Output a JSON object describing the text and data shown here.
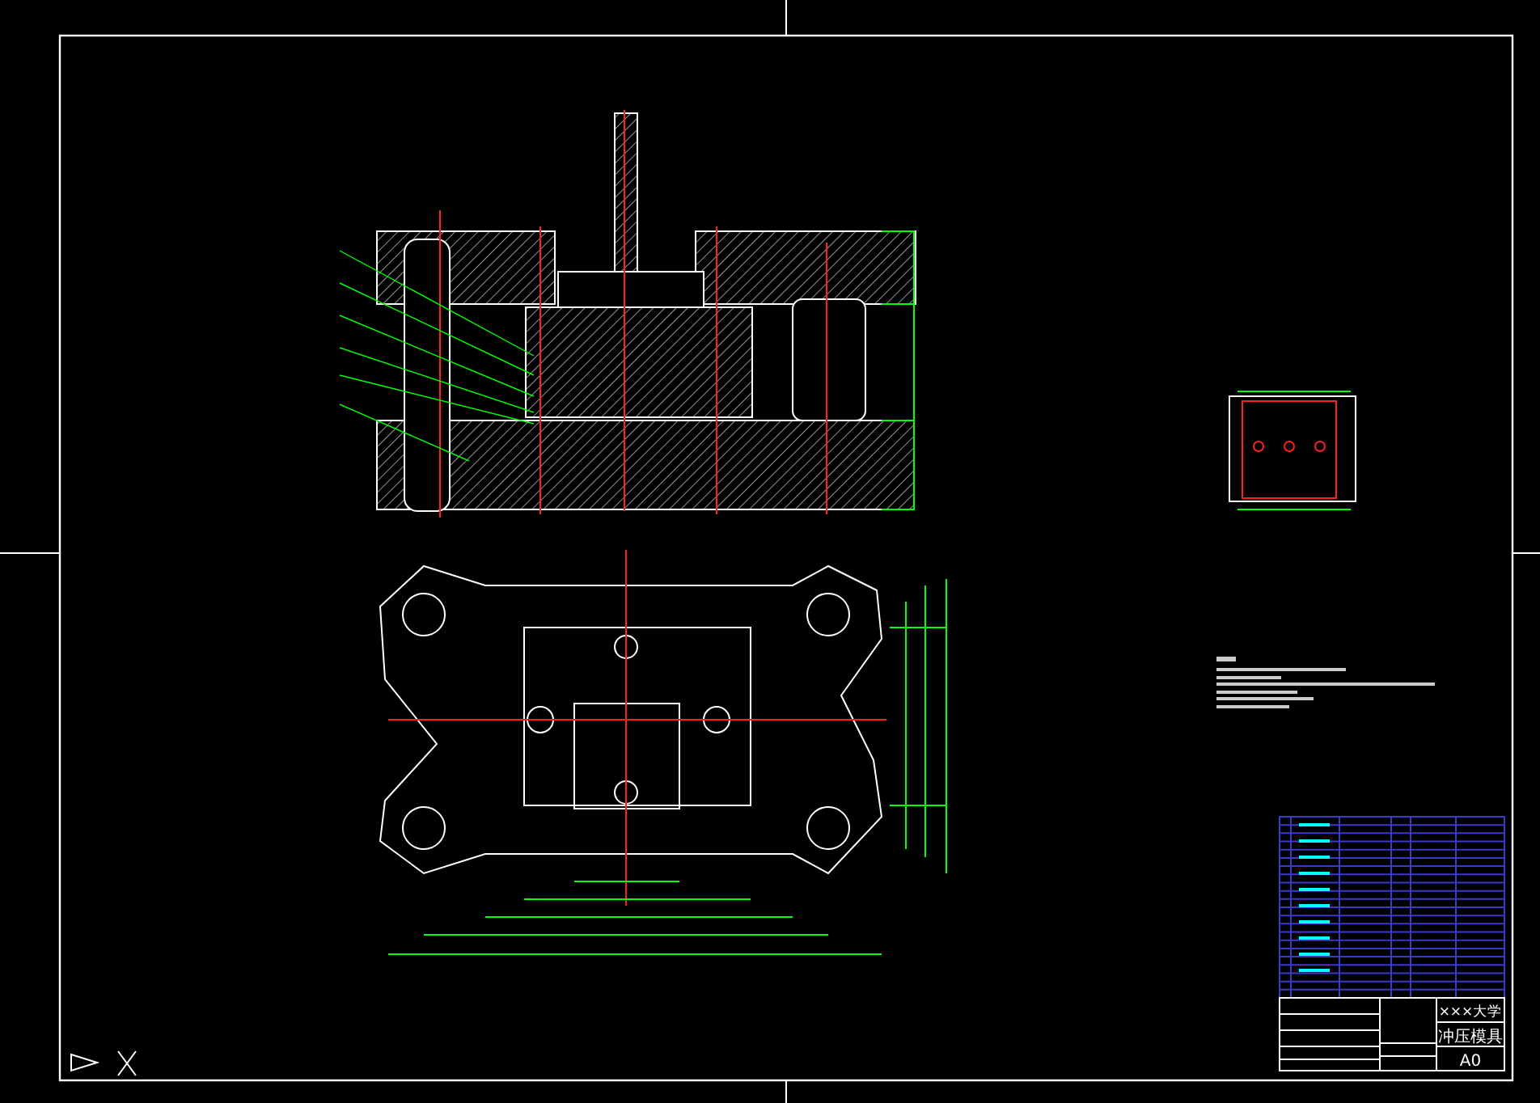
{
  "title_block": {
    "school": "×××大学",
    "drawing_name": "冲压模具",
    "sheet_size": "A0"
  }
}
